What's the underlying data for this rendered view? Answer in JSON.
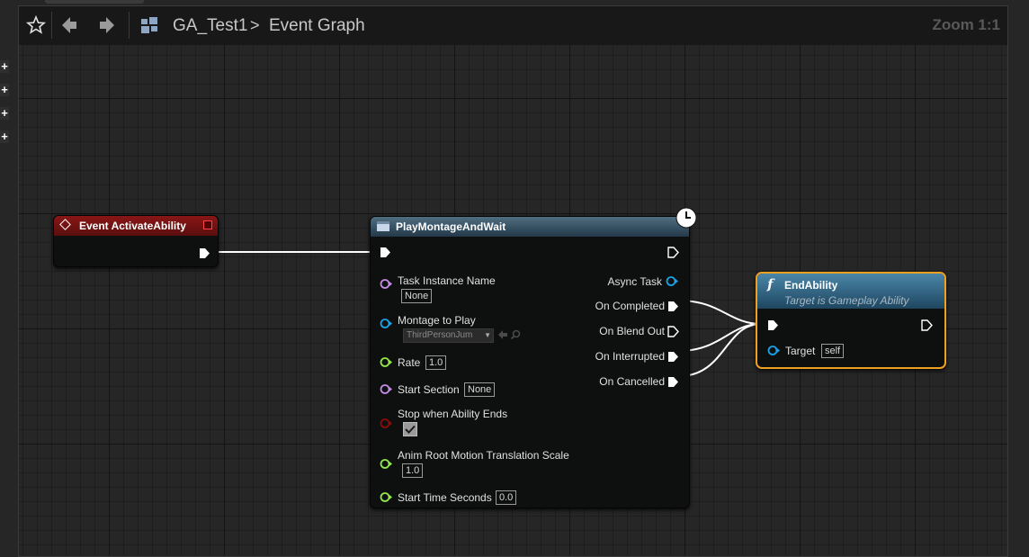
{
  "toolbar": {
    "breadcrumb_asset": "GA_Test1",
    "breadcrumb_separator": ">",
    "breadcrumb_graph": "Event Graph",
    "zoom": "Zoom 1:1"
  },
  "nodes": {
    "event_activate": {
      "title": "Event ActivateAbility",
      "header_color": "#7b1414"
    },
    "play_montage": {
      "title": "PlayMontageAndWait",
      "header_color": "#3c5a6a",
      "inputs": {
        "task_instance_name": {
          "label": "Task Instance Name",
          "value": "None"
        },
        "montage_to_play": {
          "label": "Montage to Play",
          "value": "ThirdPersonJum"
        },
        "rate": {
          "label": "Rate",
          "value": "1.0"
        },
        "start_section": {
          "label": "Start Section",
          "value": "None"
        },
        "stop_when_ability_ends": {
          "label": "Stop when Ability Ends",
          "checked": true
        },
        "anim_root_motion": {
          "label": "Anim Root Motion Translation Scale",
          "value": "1.0"
        },
        "start_time_seconds": {
          "label": "Start Time Seconds",
          "value": "0.0"
        }
      },
      "outputs": {
        "async_task": "Async Task",
        "on_completed": "On Completed",
        "on_blend_out": "On Blend Out",
        "on_interrupted": "On Interrupted",
        "on_cancelled": "On Cancelled"
      }
    },
    "end_ability": {
      "title": "EndAbility",
      "subtitle": "Target is Gameplay Ability",
      "function_glyph": "f",
      "header_color": "#3a6e8c",
      "selection_color": "#f0a020",
      "target_label": "Target",
      "target_value": "self"
    }
  },
  "colors": {
    "exec_wire": "#ffffff",
    "object_pin": "#1aa3e8",
    "name_pin": "#c58ae6",
    "float_pin": "#92e84a",
    "bool_pin": "#8a0c0c",
    "graph_bg": "#262626"
  },
  "icons": {
    "favorite": "star-icon",
    "back": "arrow-left-icon",
    "forward": "arrow-right-icon",
    "blueprint": "blueprint-icon",
    "latent": "clock-icon",
    "event": "event-diamond-icon",
    "function": "function-icon",
    "montage_use_selected": "arrow-left-icon",
    "montage_browse": "search-icon"
  }
}
